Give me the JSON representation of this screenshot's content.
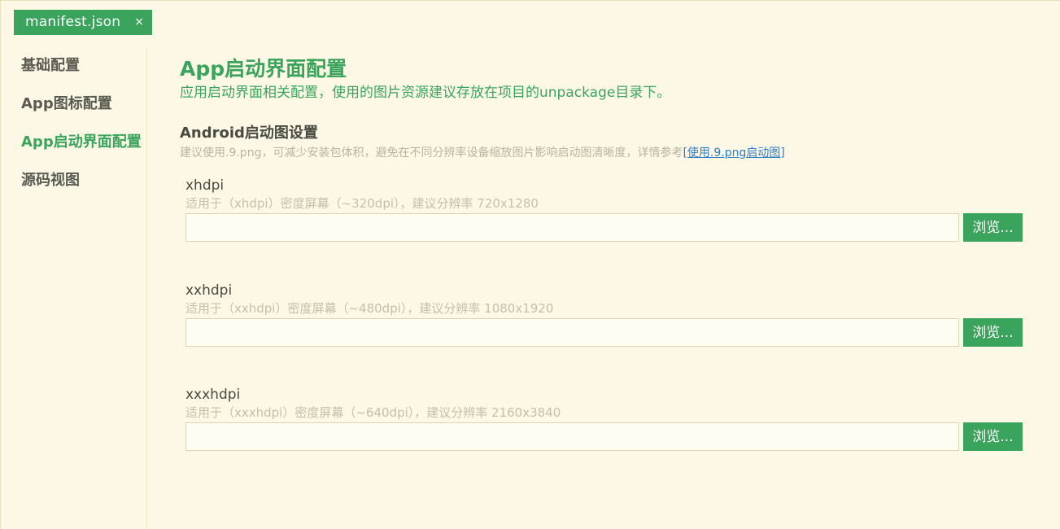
{
  "tab": {
    "label": "manifest.json",
    "close_glyph": "×"
  },
  "sidebar": {
    "items": [
      {
        "label": "基础配置"
      },
      {
        "label": "App图标配置"
      },
      {
        "label": "App启动界面配置"
      },
      {
        "label": "源码视图"
      }
    ]
  },
  "main": {
    "title": "App启动界面配置",
    "description": "应用启动界面相关配置，使用的图片资源建议存放在项目的unpackage目录下。",
    "android": {
      "title": "Android启动图设置",
      "hint": "建议使用.9.png，可减少安装包体积，避免在不同分辨率设备缩放图片影响启动图清晰度，详情参考",
      "link": "[使用.9.png启动图]",
      "fields": [
        {
          "label": "xhdpi",
          "hint": "适用于（xhdpi）密度屏幕（~320dpi），建议分辨率 720x1280",
          "value": "",
          "browse_label": "浏览..."
        },
        {
          "label": "xxhdpi",
          "hint": "适用于（xxhdpi）密度屏幕（~480dpi），建议分辨率 1080x1920",
          "value": "",
          "browse_label": "浏览..."
        },
        {
          "label": "xxxhdpi",
          "hint": "适用于（xxxhdpi）密度屏幕（~640dpi），建议分辨率 2160x3840",
          "value": "",
          "browse_label": "浏览..."
        }
      ]
    }
  },
  "colors": {
    "accent": "#3aa45c",
    "background": "#fdf8e6",
    "link": "#2f7ec8",
    "hint": "#c4bfa8"
  }
}
